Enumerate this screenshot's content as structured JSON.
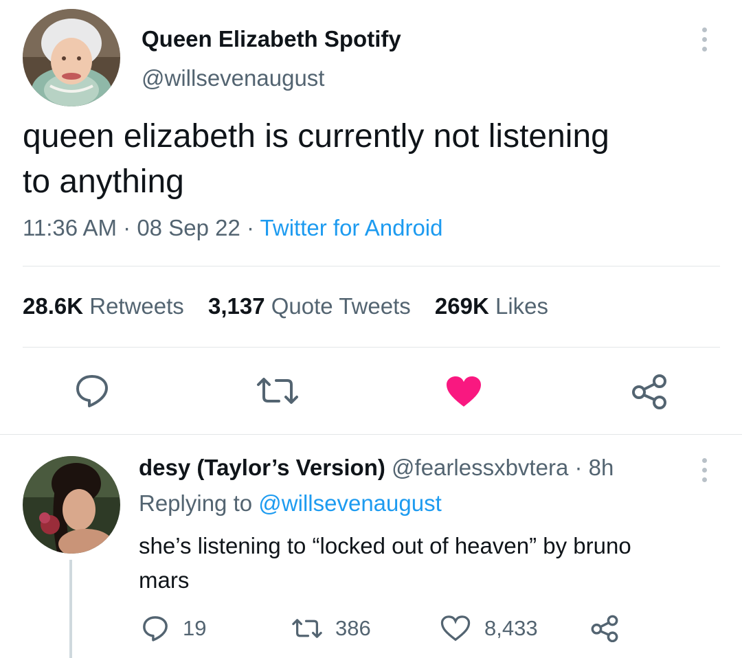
{
  "main_tweet": {
    "display_name": "Queen Elizabeth Spotify",
    "handle": "@willsevenaugust",
    "text_line1": "queen elizabeth is currently not listening",
    "text_line2": "to anything",
    "time": "11:36 AM",
    "sep1": "·",
    "date": "08 Sep 22",
    "sep2": "·",
    "source": "Twitter for Android",
    "stats": {
      "retweets_count": "28.6K",
      "retweets_label": "Retweets",
      "quotes_count": "3,137",
      "quotes_label": "Quote Tweets",
      "likes_count": "269K",
      "likes_label": "Likes"
    },
    "liked": true
  },
  "reply": {
    "display_name": "desy (Taylor’s Version)",
    "handle": "@fearlessxbvtera",
    "sep": "·",
    "time_ago": "8h",
    "replying_prefix": "Replying to",
    "replying_handle": "@willsevenaugust",
    "text_line1": "she’s listening to “locked out of heaven” by bruno",
    "text_line2": "mars",
    "reply_count": "19",
    "retweet_count": "386",
    "like_count": "8,433"
  },
  "colors": {
    "like_pink": "#f91880",
    "link_blue": "#1d9bf0",
    "muted_gray": "#536471"
  },
  "icons": [
    "reply-icon",
    "retweet-icon",
    "heart-icon",
    "share-icon",
    "more-icon"
  ]
}
